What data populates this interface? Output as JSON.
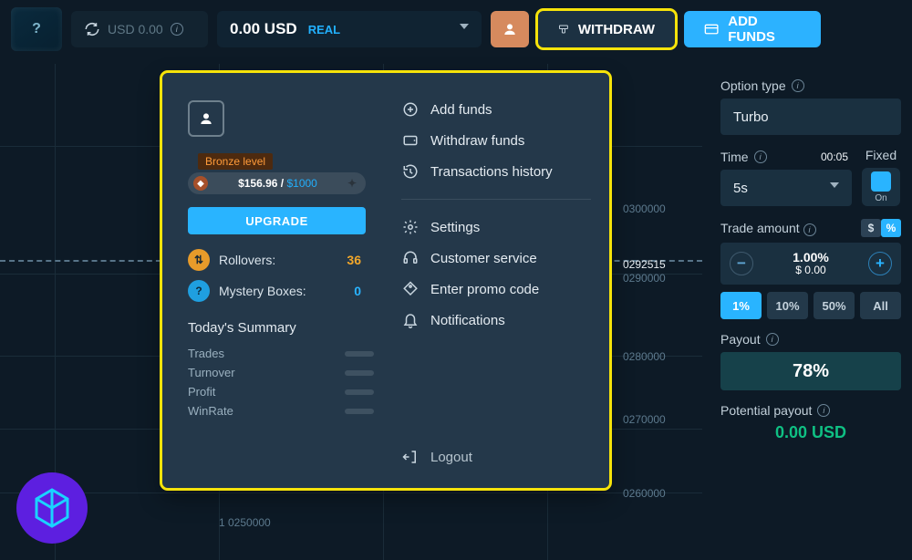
{
  "topbar": {
    "credits_label": "USD 0.00",
    "balance_amount": "0.00 USD",
    "balance_type": "REAL",
    "withdraw_label": "WITHDRAW",
    "addfunds_label": "ADD FUNDS"
  },
  "chart": {
    "prices": [
      "0300000",
      "0292515",
      "0280000",
      "0270000",
      "0260000"
    ],
    "bottom_label": "1 0250000",
    "extra_price": "0290000"
  },
  "profile": {
    "level_tag": "Bronze level",
    "bal_current": "$156.96",
    "bal_sep": " / ",
    "bal_max": "$1000",
    "upgrade": "UPGRADE",
    "stats": {
      "rollovers_label": "Rollovers:",
      "rollovers_val": "36",
      "mystery_label": "Mystery Boxes:",
      "mystery_val": "0"
    },
    "summary_title": "Today's Summary",
    "summary": [
      "Trades",
      "Turnover",
      "Profit",
      "WinRate"
    ]
  },
  "menu": {
    "add_funds": "Add funds",
    "withdraw": "Withdraw funds",
    "transactions": "Transactions history",
    "settings": "Settings",
    "support": "Customer service",
    "promo": "Enter promo code",
    "notifications": "Notifications",
    "logout": "Logout"
  },
  "sidebar": {
    "option_type_label": "Option type",
    "option_type_value": "Turbo",
    "time_label": "Time",
    "time_val": "00:05",
    "fixed_label": "Fixed",
    "time_select": "5s",
    "toggle_state": "On",
    "trade_amount_label": "Trade amount",
    "amount_pct": "1.00%",
    "amount_usd": "$ 0.00",
    "chips": [
      "1%",
      "10%",
      "50%",
      "All"
    ],
    "payout_label": "Payout",
    "payout_value": "78%",
    "potential_label": "Potential payout",
    "potential_value": "0.00 USD"
  }
}
